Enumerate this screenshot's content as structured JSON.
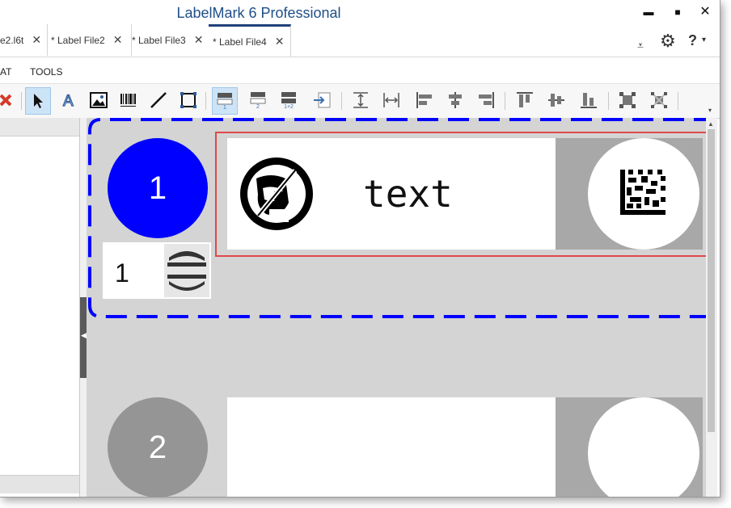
{
  "app": {
    "title": "LabelMark 6 Professional"
  },
  "window_controls": {
    "minimize": "▬",
    "maximize": "■",
    "close": "✕"
  },
  "tabs": [
    {
      "label": "e2.l6t",
      "close": "✕"
    },
    {
      "label": "* Label File2",
      "close": "✕"
    },
    {
      "label": "* Label File3",
      "close": "✕"
    },
    {
      "label": "* Label File4",
      "close": "✕"
    }
  ],
  "tab_right": {
    "settings": "⚙",
    "help": "?",
    "help_caret": "▾",
    "overflow": "⩡"
  },
  "menu": [
    "AT",
    "TOOLS"
  ],
  "toolbar": {
    "layout_labels": [
      "1",
      "2",
      "1+2"
    ]
  },
  "labels": [
    {
      "number": "1",
      "text": "text",
      "color": "#0000ff"
    },
    {
      "number": "2",
      "color": "#959595"
    }
  ],
  "copies": {
    "value": "1"
  },
  "colors": {
    "selection_dash": "#0000ff",
    "selection_box": "#e0484a"
  }
}
